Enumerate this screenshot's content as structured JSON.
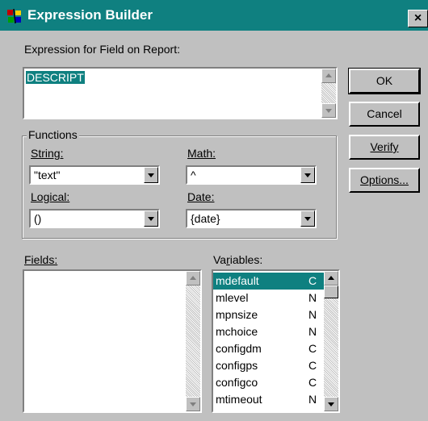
{
  "window": {
    "title": "Expression Builder",
    "close_label": "×"
  },
  "expression": {
    "label": "Expression for Field on Report:",
    "value": "DESCRIPT"
  },
  "buttons": {
    "ok": "OK",
    "cancel": "Cancel",
    "verify": "Verify",
    "options": "Options..."
  },
  "functions": {
    "label": "Functions",
    "string": {
      "label": "String:",
      "value": "\"text\""
    },
    "math": {
      "label": "Math:",
      "value": "^"
    },
    "logical": {
      "label": "Logical:",
      "value": "()"
    },
    "date": {
      "label": "Date:",
      "value": "{date}"
    }
  },
  "fields": {
    "label": "Fields:"
  },
  "variables": {
    "label": "Variables:",
    "items": [
      {
        "name": "mdefault",
        "type": "C",
        "selected": true
      },
      {
        "name": "mlevel",
        "type": "N"
      },
      {
        "name": "mpnsize",
        "type": "N"
      },
      {
        "name": "mchoice",
        "type": "N"
      },
      {
        "name": "configdm",
        "type": "C"
      },
      {
        "name": "configps",
        "type": "C"
      },
      {
        "name": "configco",
        "type": "C"
      },
      {
        "name": "mtimeout",
        "type": "N"
      }
    ]
  },
  "colors": {
    "titlebar": "#0f8080",
    "selection": "#0f8080",
    "face": "#c0c0c0"
  },
  "icons": {
    "app": "report-builder-icon",
    "close": "close-icon"
  }
}
